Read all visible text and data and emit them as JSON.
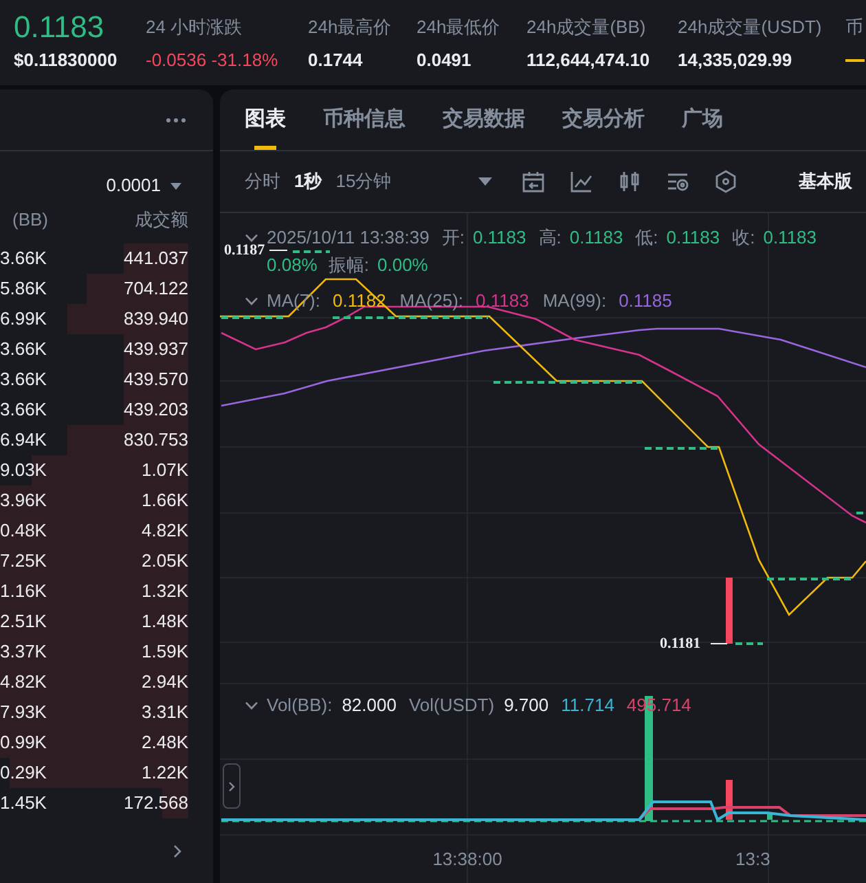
{
  "market_header": {
    "price": "0.1183",
    "price_usd": "$0.11830000",
    "stats": [
      {
        "kind": "change",
        "label": "24 小时涨跌",
        "value": "-0.0536 -31.18%"
      },
      {
        "kind": "plain",
        "label": "24h最高价",
        "value": "0.1744"
      },
      {
        "kind": "plain",
        "label": "24h最低价",
        "value": "0.0491"
      },
      {
        "kind": "plain",
        "label": "24h成交量(BB)",
        "value": "112,644,474.10"
      },
      {
        "kind": "plain",
        "label": "24h成交量(USDT)",
        "value": "14,335,029.99"
      },
      {
        "kind": "dash",
        "label": "币"
      }
    ]
  },
  "order_book": {
    "precision": "0.0001",
    "columns": [
      "(BB)",
      "成交额"
    ],
    "rows": [
      {
        "quantity": "3.66K",
        "turnover": "441.037",
        "level": 0.34
      },
      {
        "quantity": "5.86K",
        "turnover": "704.122",
        "level": 0.54
      },
      {
        "quantity": "6.99K",
        "turnover": "839.940",
        "level": 0.64
      },
      {
        "quantity": "3.66K",
        "turnover": "439.937",
        "level": 0.34
      },
      {
        "quantity": "3.66K",
        "turnover": "439.570",
        "level": 0.34
      },
      {
        "quantity": "3.66K",
        "turnover": "439.203",
        "level": 0.34
      },
      {
        "quantity": "6.94K",
        "turnover": "830.753",
        "level": 0.64
      },
      {
        "quantity": "9.03K",
        "turnover": "1.07K",
        "level": 0.83
      },
      {
        "quantity": "3.96K",
        "turnover": "1.66K",
        "level": 1
      },
      {
        "quantity": "0.48K",
        "turnover": "4.82K",
        "level": 1
      },
      {
        "quantity": "7.25K",
        "turnover": "2.05K",
        "level": 1
      },
      {
        "quantity": "1.16K",
        "turnover": "1.32K",
        "level": 1
      },
      {
        "quantity": "2.51K",
        "turnover": "1.48K",
        "level": 1
      },
      {
        "quantity": "3.37K",
        "turnover": "1.59K",
        "level": 1
      },
      {
        "quantity": "4.82K",
        "turnover": "2.94K",
        "level": 1
      },
      {
        "quantity": "7.93K",
        "turnover": "3.31K",
        "level": 1
      },
      {
        "quantity": "0.99K",
        "turnover": "2.48K",
        "level": 1
      },
      {
        "quantity": "0.29K",
        "turnover": "1.22K",
        "level": 0.95
      },
      {
        "quantity": "1.45K",
        "turnover": "172.568",
        "level": 0.14
      }
    ]
  },
  "chart_panel": {
    "tabs": [
      {
        "label": "图表",
        "selected": true
      },
      {
        "label": "币种信息",
        "selected": false
      },
      {
        "label": "交易数据",
        "selected": false
      },
      {
        "label": "交易分析",
        "selected": false
      },
      {
        "label": "广场",
        "selected": false
      }
    ],
    "intervals": [
      {
        "label": "分时",
        "selected": false
      },
      {
        "label": "1秒",
        "selected": true
      },
      {
        "label": "15分钟",
        "selected": false
      }
    ],
    "edition": "基本版",
    "ohlc_legend": {
      "datetime": "2025/10/11 13:38:39",
      "fields": [
        {
          "label": "开:",
          "value": "0.1183"
        },
        {
          "label": "高:",
          "value": "0.1183"
        },
        {
          "label": "低:",
          "value": "0.1183"
        },
        {
          "label": "收:",
          "value": "0.1183"
        }
      ],
      "more_fields": [
        {
          "value": "0.08%"
        },
        {
          "label": "振幅:",
          "value": "0.00%"
        }
      ]
    },
    "ma_legend": [
      {
        "label": "MA(7):",
        "value": "0.1182",
        "color": "#f0b90b"
      },
      {
        "label": "MA(25):",
        "value": "0.1183",
        "color": "#d6338a"
      },
      {
        "label": "MA(99):",
        "value": "0.1185",
        "color": "#9966dd"
      }
    ],
    "high_marker": "0.1187",
    "low_marker": "0.1181",
    "volume_legend": [
      {
        "label": "Vol(BB):",
        "value": "82.000"
      },
      {
        "label": "Vol(USDT)",
        "value": "9.700"
      },
      {
        "value": "11.714",
        "color": "#3bb5d6"
      },
      {
        "value": "495.714",
        "color": "#d9436b"
      }
    ],
    "x_axis": [
      "13:38:00",
      "13:3"
    ]
  }
}
